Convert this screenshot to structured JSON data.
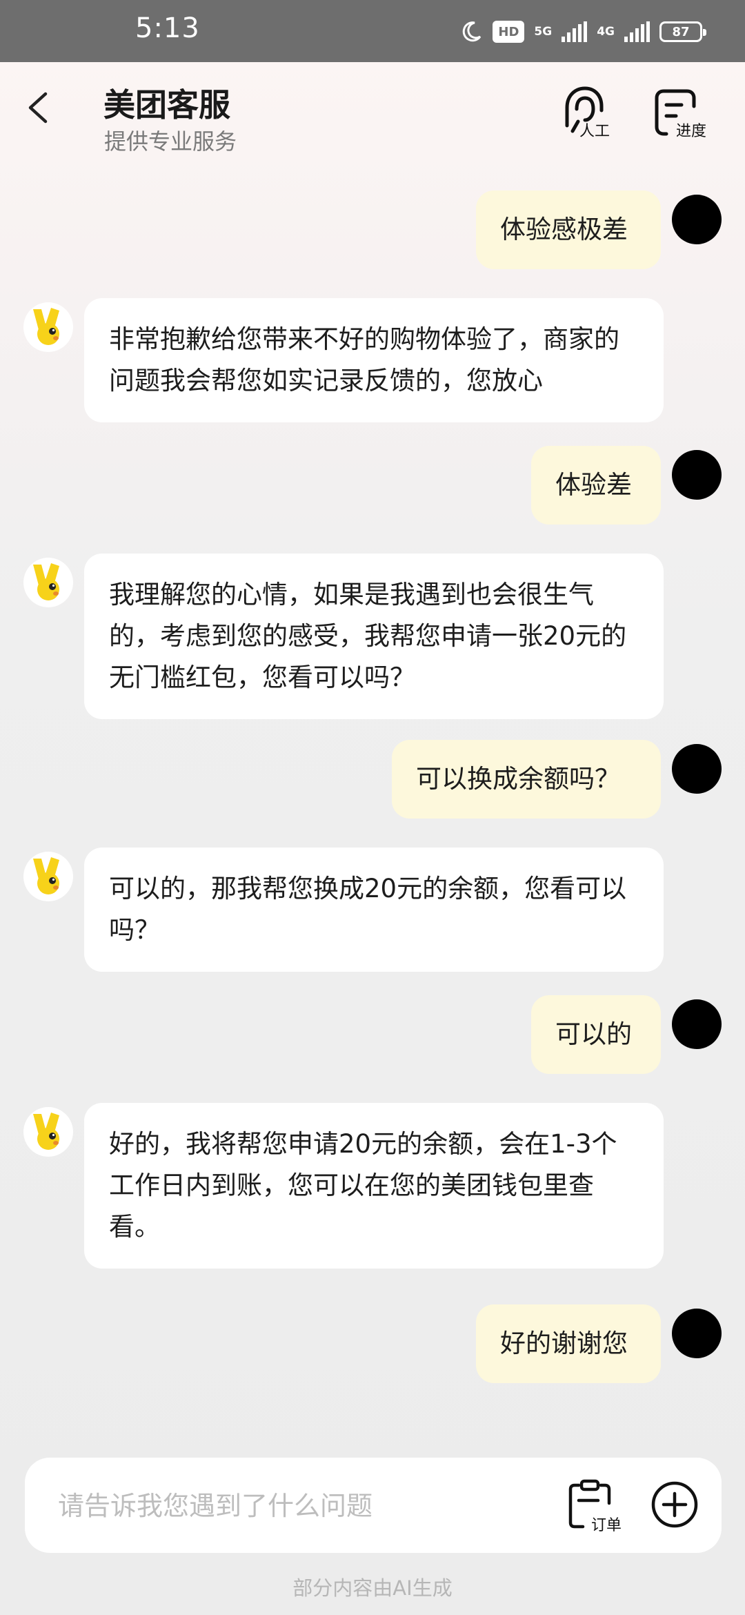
{
  "status_bar": {
    "time": "5:13",
    "hd_label": "HD",
    "net1": "5G",
    "net2": "4G",
    "battery": "87"
  },
  "header": {
    "title": "美团客服",
    "subtitle": "提供专业服务",
    "human_label": "人工",
    "progress_label": "进度"
  },
  "messages": [
    {
      "role": "user",
      "text": "体验感极差"
    },
    {
      "role": "bot",
      "text": "非常抱歉给您带来不好的购物体验了，商家的问题我会帮您如实记录反馈的，您放心"
    },
    {
      "role": "user",
      "text": "体验差"
    },
    {
      "role": "bot",
      "text": "我理解您的心情，如果是我遇到也会很生气的，考虑到您的感受，我帮您申请一张20元的无门槛红包，您看可以吗？"
    },
    {
      "role": "user",
      "text": "可以换成余额吗？"
    },
    {
      "role": "bot",
      "text": "可以的，那我帮您换成20元的余额，您看可以吗？"
    },
    {
      "role": "user",
      "text": "可以的"
    },
    {
      "role": "bot",
      "text": "好的，我将帮您申请20元的余额，会在1-3个工作日内到账，您可以在您的美团钱包里查看。"
    },
    {
      "role": "user",
      "text": "好的谢谢您"
    }
  ],
  "input": {
    "placeholder": "请告诉我您遇到了什么问题",
    "order_label": "订单"
  },
  "footer_note": "部分内容由AI生成",
  "colors": {
    "user_bubble": "#fdf8dc",
    "bot_bubble": "#ffffff",
    "mascot_yellow": "#f7d21a"
  }
}
